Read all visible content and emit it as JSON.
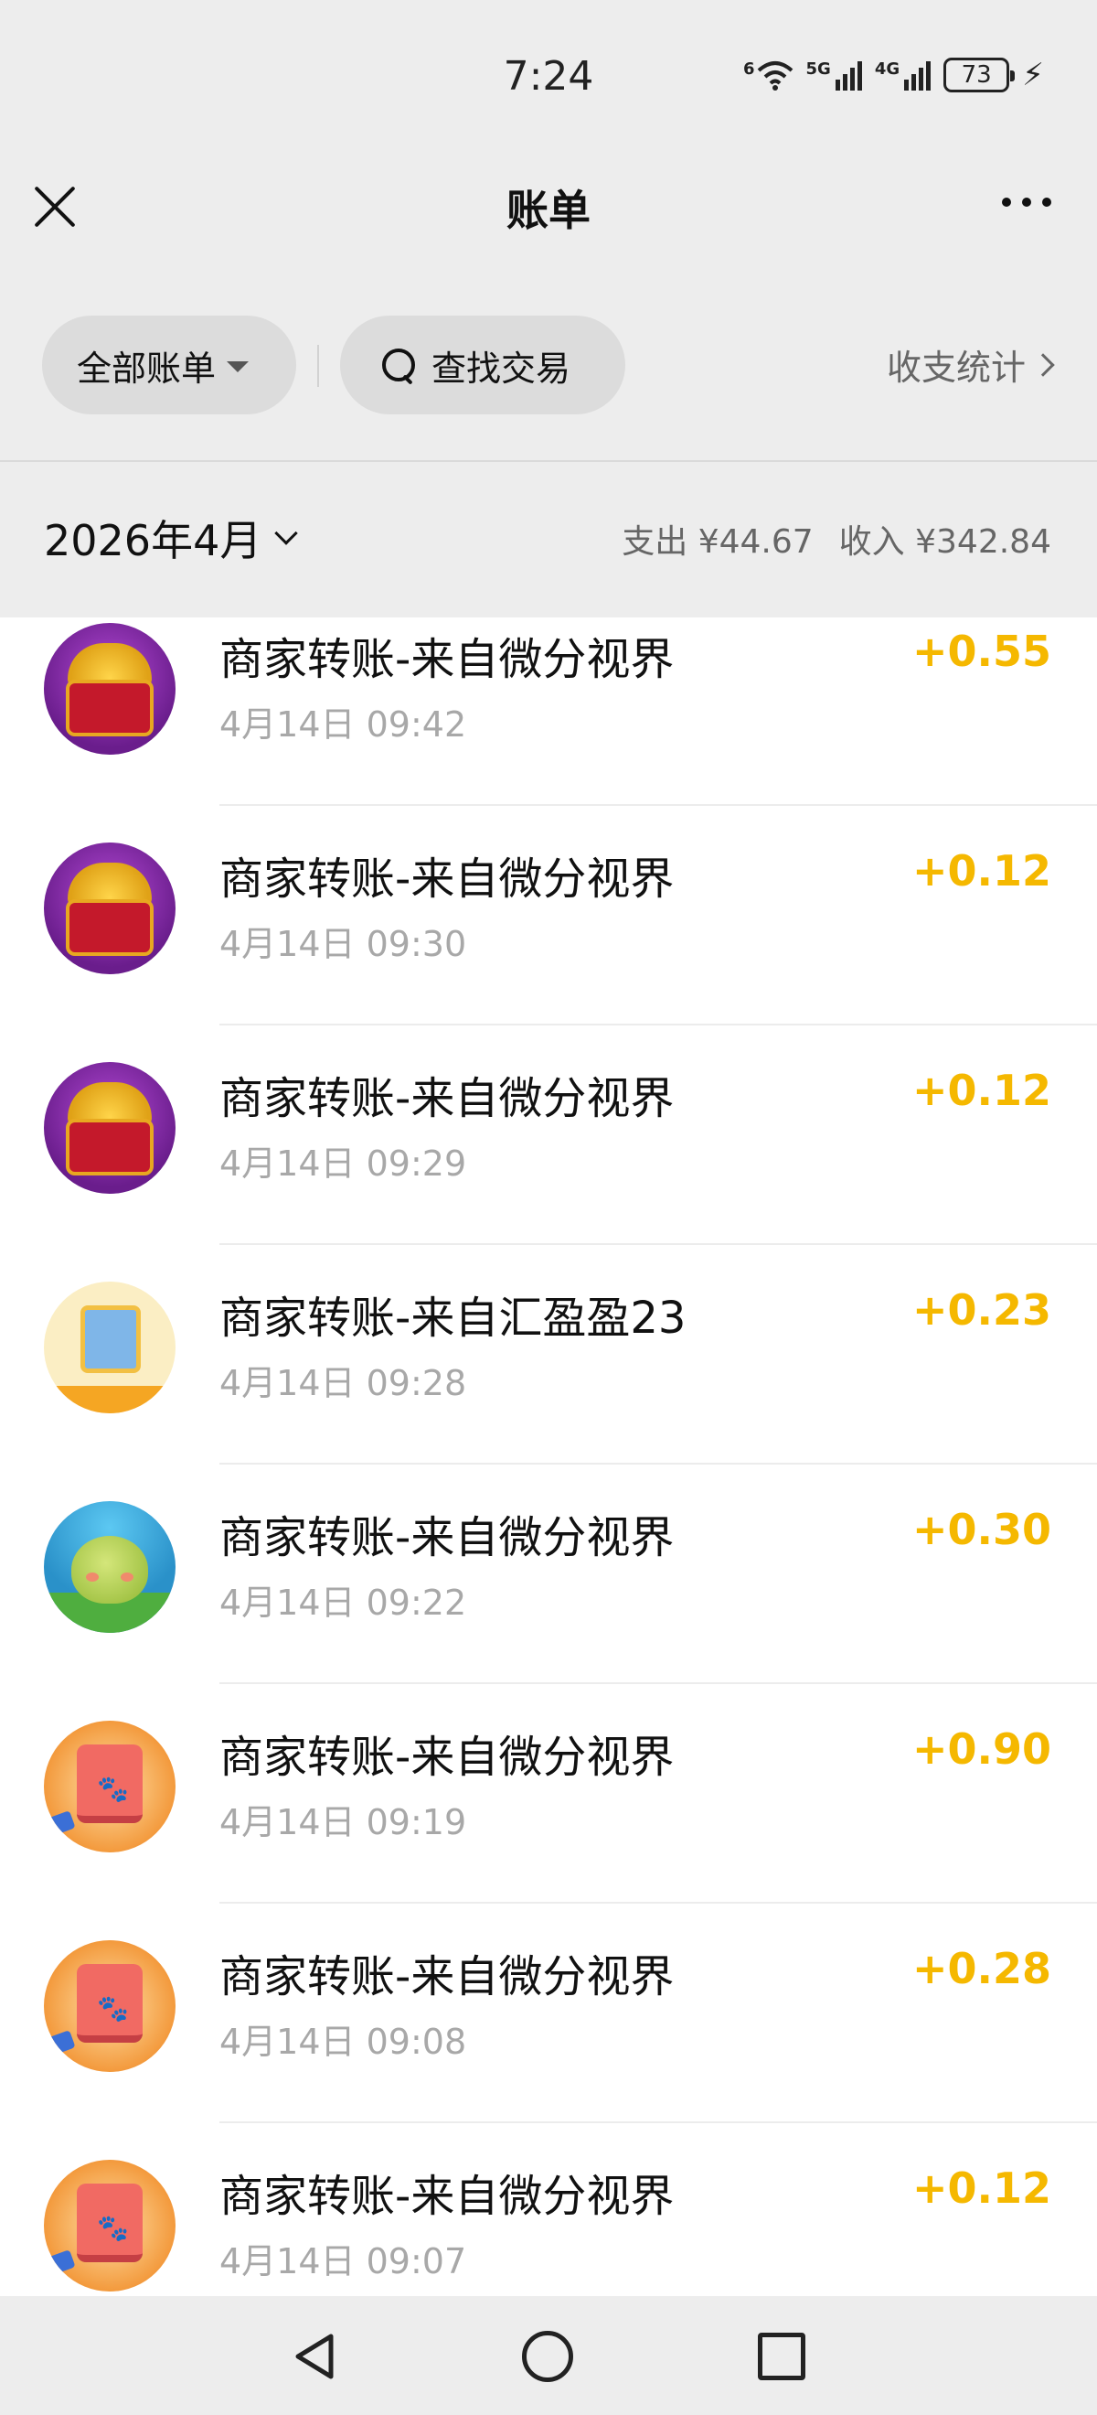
{
  "status_bar": {
    "time": "7:24",
    "wifi_label": "6",
    "signal1_label": "5G",
    "signal2_label": "4G",
    "battery": "73",
    "charging_icon": "lightning-bolt-icon"
  },
  "header": {
    "title": "账单",
    "close_icon": "close-icon",
    "more_icon": "more-icon"
  },
  "filter": {
    "all_bills": "全部账单",
    "search": "查找交易",
    "stats": "收支统计"
  },
  "month": {
    "label": "2026年4月",
    "expense": "支出 ¥44.67",
    "income": "收入 ¥342.84"
  },
  "transactions": [
    {
      "title": "商家转账-来自微分视界",
      "time": "4月14日 09:42",
      "amount": "+0.55",
      "avatar": "treasure-chest"
    },
    {
      "title": "商家转账-来自微分视界",
      "time": "4月14日 09:30",
      "amount": "+0.12",
      "avatar": "treasure-chest"
    },
    {
      "title": "商家转账-来自微分视界",
      "time": "4月14日 09:29",
      "amount": "+0.12",
      "avatar": "treasure-chest"
    },
    {
      "title": "商家转账-来自汇盈盈23",
      "time": "4月14日 09:28",
      "amount": "+0.23",
      "avatar": "book"
    },
    {
      "title": "商家转账-来自微分视界",
      "time": "4月14日 09:22",
      "amount": "+0.30",
      "avatar": "slime"
    },
    {
      "title": "商家转账-来自微分视界",
      "time": "4月14日 09:19",
      "amount": "+0.90",
      "avatar": "paw-tile"
    },
    {
      "title": "商家转账-来自微分视界",
      "time": "4月14日 09:08",
      "amount": "+0.28",
      "avatar": "paw-tile"
    },
    {
      "title": "商家转账-来自微分视界",
      "time": "4月14日 09:07",
      "amount": "+0.12",
      "avatar": "paw-tile"
    }
  ],
  "colors": {
    "amount": "#f5b800",
    "background": "#ededed"
  }
}
